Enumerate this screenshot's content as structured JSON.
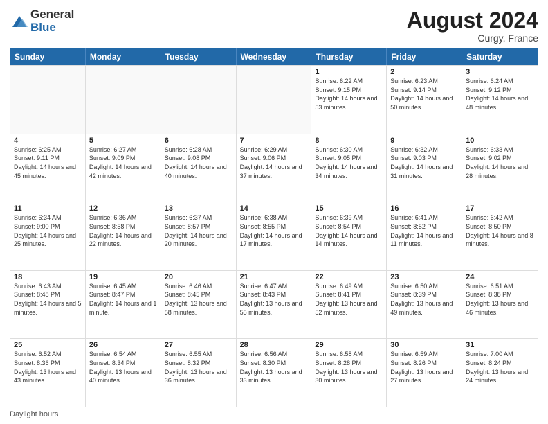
{
  "header": {
    "logo_general": "General",
    "logo_blue": "Blue",
    "month_title": "August 2024",
    "location": "Curgy, France"
  },
  "footer": {
    "note": "Daylight hours"
  },
  "days_of_week": [
    "Sunday",
    "Monday",
    "Tuesday",
    "Wednesday",
    "Thursday",
    "Friday",
    "Saturday"
  ],
  "weeks": [
    [
      {
        "day": "",
        "sunrise": "",
        "sunset": "",
        "daylight": ""
      },
      {
        "day": "",
        "sunrise": "",
        "sunset": "",
        "daylight": ""
      },
      {
        "day": "",
        "sunrise": "",
        "sunset": "",
        "daylight": ""
      },
      {
        "day": "",
        "sunrise": "",
        "sunset": "",
        "daylight": ""
      },
      {
        "day": "1",
        "sunrise": "Sunrise: 6:22 AM",
        "sunset": "Sunset: 9:15 PM",
        "daylight": "Daylight: 14 hours and 53 minutes."
      },
      {
        "day": "2",
        "sunrise": "Sunrise: 6:23 AM",
        "sunset": "Sunset: 9:14 PM",
        "daylight": "Daylight: 14 hours and 50 minutes."
      },
      {
        "day": "3",
        "sunrise": "Sunrise: 6:24 AM",
        "sunset": "Sunset: 9:12 PM",
        "daylight": "Daylight: 14 hours and 48 minutes."
      }
    ],
    [
      {
        "day": "4",
        "sunrise": "Sunrise: 6:25 AM",
        "sunset": "Sunset: 9:11 PM",
        "daylight": "Daylight: 14 hours and 45 minutes."
      },
      {
        "day": "5",
        "sunrise": "Sunrise: 6:27 AM",
        "sunset": "Sunset: 9:09 PM",
        "daylight": "Daylight: 14 hours and 42 minutes."
      },
      {
        "day": "6",
        "sunrise": "Sunrise: 6:28 AM",
        "sunset": "Sunset: 9:08 PM",
        "daylight": "Daylight: 14 hours and 40 minutes."
      },
      {
        "day": "7",
        "sunrise": "Sunrise: 6:29 AM",
        "sunset": "Sunset: 9:06 PM",
        "daylight": "Daylight: 14 hours and 37 minutes."
      },
      {
        "day": "8",
        "sunrise": "Sunrise: 6:30 AM",
        "sunset": "Sunset: 9:05 PM",
        "daylight": "Daylight: 14 hours and 34 minutes."
      },
      {
        "day": "9",
        "sunrise": "Sunrise: 6:32 AM",
        "sunset": "Sunset: 9:03 PM",
        "daylight": "Daylight: 14 hours and 31 minutes."
      },
      {
        "day": "10",
        "sunrise": "Sunrise: 6:33 AM",
        "sunset": "Sunset: 9:02 PM",
        "daylight": "Daylight: 14 hours and 28 minutes."
      }
    ],
    [
      {
        "day": "11",
        "sunrise": "Sunrise: 6:34 AM",
        "sunset": "Sunset: 9:00 PM",
        "daylight": "Daylight: 14 hours and 25 minutes."
      },
      {
        "day": "12",
        "sunrise": "Sunrise: 6:36 AM",
        "sunset": "Sunset: 8:58 PM",
        "daylight": "Daylight: 14 hours and 22 minutes."
      },
      {
        "day": "13",
        "sunrise": "Sunrise: 6:37 AM",
        "sunset": "Sunset: 8:57 PM",
        "daylight": "Daylight: 14 hours and 20 minutes."
      },
      {
        "day": "14",
        "sunrise": "Sunrise: 6:38 AM",
        "sunset": "Sunset: 8:55 PM",
        "daylight": "Daylight: 14 hours and 17 minutes."
      },
      {
        "day": "15",
        "sunrise": "Sunrise: 6:39 AM",
        "sunset": "Sunset: 8:54 PM",
        "daylight": "Daylight: 14 hours and 14 minutes."
      },
      {
        "day": "16",
        "sunrise": "Sunrise: 6:41 AM",
        "sunset": "Sunset: 8:52 PM",
        "daylight": "Daylight: 14 hours and 11 minutes."
      },
      {
        "day": "17",
        "sunrise": "Sunrise: 6:42 AM",
        "sunset": "Sunset: 8:50 PM",
        "daylight": "Daylight: 14 hours and 8 minutes."
      }
    ],
    [
      {
        "day": "18",
        "sunrise": "Sunrise: 6:43 AM",
        "sunset": "Sunset: 8:48 PM",
        "daylight": "Daylight: 14 hours and 5 minutes."
      },
      {
        "day": "19",
        "sunrise": "Sunrise: 6:45 AM",
        "sunset": "Sunset: 8:47 PM",
        "daylight": "Daylight: 14 hours and 1 minute."
      },
      {
        "day": "20",
        "sunrise": "Sunrise: 6:46 AM",
        "sunset": "Sunset: 8:45 PM",
        "daylight": "Daylight: 13 hours and 58 minutes."
      },
      {
        "day": "21",
        "sunrise": "Sunrise: 6:47 AM",
        "sunset": "Sunset: 8:43 PM",
        "daylight": "Daylight: 13 hours and 55 minutes."
      },
      {
        "day": "22",
        "sunrise": "Sunrise: 6:49 AM",
        "sunset": "Sunset: 8:41 PM",
        "daylight": "Daylight: 13 hours and 52 minutes."
      },
      {
        "day": "23",
        "sunrise": "Sunrise: 6:50 AM",
        "sunset": "Sunset: 8:39 PM",
        "daylight": "Daylight: 13 hours and 49 minutes."
      },
      {
        "day": "24",
        "sunrise": "Sunrise: 6:51 AM",
        "sunset": "Sunset: 8:38 PM",
        "daylight": "Daylight: 13 hours and 46 minutes."
      }
    ],
    [
      {
        "day": "25",
        "sunrise": "Sunrise: 6:52 AM",
        "sunset": "Sunset: 8:36 PM",
        "daylight": "Daylight: 13 hours and 43 minutes."
      },
      {
        "day": "26",
        "sunrise": "Sunrise: 6:54 AM",
        "sunset": "Sunset: 8:34 PM",
        "daylight": "Daylight: 13 hours and 40 minutes."
      },
      {
        "day": "27",
        "sunrise": "Sunrise: 6:55 AM",
        "sunset": "Sunset: 8:32 PM",
        "daylight": "Daylight: 13 hours and 36 minutes."
      },
      {
        "day": "28",
        "sunrise": "Sunrise: 6:56 AM",
        "sunset": "Sunset: 8:30 PM",
        "daylight": "Daylight: 13 hours and 33 minutes."
      },
      {
        "day": "29",
        "sunrise": "Sunrise: 6:58 AM",
        "sunset": "Sunset: 8:28 PM",
        "daylight": "Daylight: 13 hours and 30 minutes."
      },
      {
        "day": "30",
        "sunrise": "Sunrise: 6:59 AM",
        "sunset": "Sunset: 8:26 PM",
        "daylight": "Daylight: 13 hours and 27 minutes."
      },
      {
        "day": "31",
        "sunrise": "Sunrise: 7:00 AM",
        "sunset": "Sunset: 8:24 PM",
        "daylight": "Daylight: 13 hours and 24 minutes."
      }
    ]
  ]
}
